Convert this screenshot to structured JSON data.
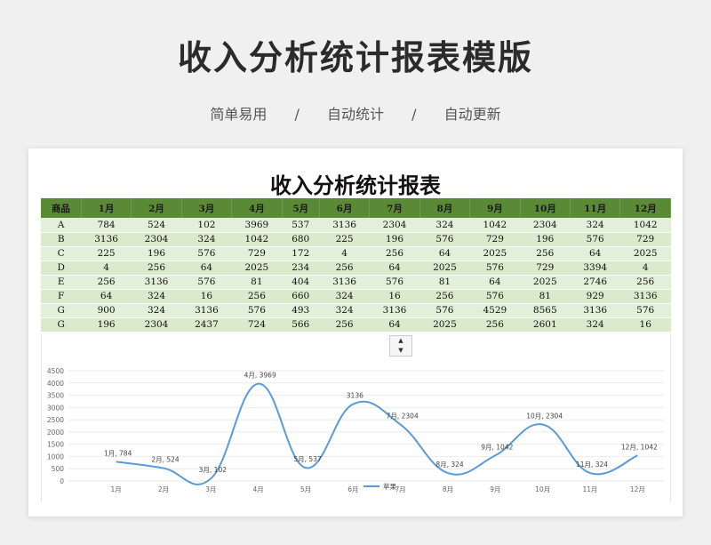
{
  "header": {
    "title": "收入分析统计报表模版",
    "tags": [
      "简单易用",
      "/",
      "自动统计",
      "/",
      "自动更新"
    ]
  },
  "sheet": {
    "title": "收入分析统计报表",
    "columns": [
      "商品",
      "1月",
      "2月",
      "3月",
      "4月",
      "5月",
      "6月",
      "7月",
      "8月",
      "9月",
      "10月",
      "11月",
      "12月"
    ],
    "rows": [
      [
        "A",
        "784",
        "524",
        "102",
        "3969",
        "537",
        "3136",
        "2304",
        "324",
        "1042",
        "2304",
        "324",
        "1042"
      ],
      [
        "B",
        "3136",
        "2304",
        "324",
        "1042",
        "680",
        "225",
        "196",
        "576",
        "729",
        "196",
        "576",
        "729"
      ],
      [
        "C",
        "225",
        "196",
        "576",
        "729",
        "172",
        "4",
        "256",
        "64",
        "2025",
        "256",
        "64",
        "2025"
      ],
      [
        "D",
        "4",
        "256",
        "64",
        "2025",
        "234",
        "256",
        "64",
        "2025",
        "576",
        "729",
        "3394",
        "4"
      ],
      [
        "E",
        "256",
        "3136",
        "576",
        "81",
        "404",
        "3136",
        "576",
        "81",
        "64",
        "2025",
        "2746",
        "256"
      ],
      [
        "F",
        "64",
        "324",
        "16",
        "256",
        "660",
        "324",
        "16",
        "256",
        "576",
        "81",
        "929",
        "3136"
      ],
      [
        "G",
        "900",
        "324",
        "3136",
        "576",
        "493",
        "324",
        "3136",
        "576",
        "4529",
        "8565",
        "3136",
        "576"
      ],
      [
        "G",
        "196",
        "2304",
        "2437",
        "724",
        "566",
        "256",
        "64",
        "2025",
        "256",
        "2601",
        "324",
        "16"
      ]
    ],
    "spinner": {
      "up": "▲",
      "down": "▼"
    }
  },
  "chart_data": {
    "type": "line",
    "categories": [
      "1月",
      "2月",
      "3月",
      "4月",
      "5月",
      "6月",
      "7月",
      "8月",
      "9月",
      "10月",
      "11月",
      "12月"
    ],
    "series": [
      {
        "name": "苹果",
        "values": [
          784,
          524,
          102,
          3969,
          537,
          3136,
          2304,
          324,
          1042,
          2304,
          324,
          1042
        ],
        "color": "#5b9bd5"
      }
    ],
    "data_labels": [
      "1月, 784",
      "2月, 524",
      "3月, 102",
      "4月, 3969",
      "5月, 537",
      "3136",
      "7月, 2304",
      "8月, 324",
      "9月, 1042",
      "10月, 2304",
      "11月, 324",
      "12月, 1042"
    ],
    "yticks": [
      "0",
      "500",
      "1000",
      "1500",
      "2000",
      "2500",
      "3000",
      "3500",
      "4000",
      "4500"
    ],
    "ylim": [
      0,
      4500
    ],
    "grid": true,
    "legend_position": "bottom"
  }
}
